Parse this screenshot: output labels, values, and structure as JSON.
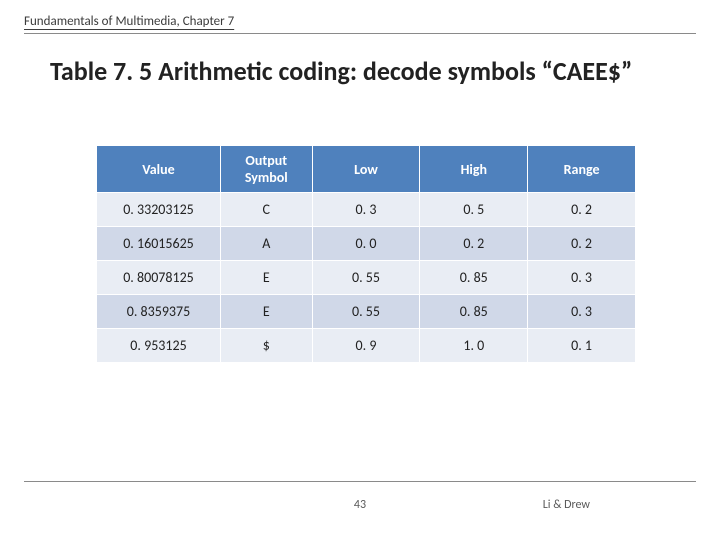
{
  "header": "Fundamentals of Multimedia, Chapter 7",
  "title": "Table 7. 5 Arithmetic coding: decode symbols “CAEE$”",
  "table": {
    "columns": [
      "Value",
      "Output Symbol",
      "Low",
      "High",
      "Range"
    ],
    "rows": [
      {
        "value": "0. 33203125",
        "symbol": "C",
        "low": "0. 3",
        "high": "0. 5",
        "range": "0. 2"
      },
      {
        "value": "0. 16015625",
        "symbol": "A",
        "low": "0. 0",
        "high": "0. 2",
        "range": "0. 2"
      },
      {
        "value": "0. 80078125",
        "symbol": "E",
        "low": "0. 55",
        "high": "0. 85",
        "range": "0. 3"
      },
      {
        "value": "0. 8359375",
        "symbol": "E",
        "low": "0. 55",
        "high": "0. 85",
        "range": "0. 3"
      },
      {
        "value": "0. 953125",
        "symbol": "$",
        "low": "0. 9",
        "high": "1. 0",
        "range": "0. 1"
      }
    ]
  },
  "footer": {
    "page": "43",
    "authors": "Li & Drew"
  }
}
